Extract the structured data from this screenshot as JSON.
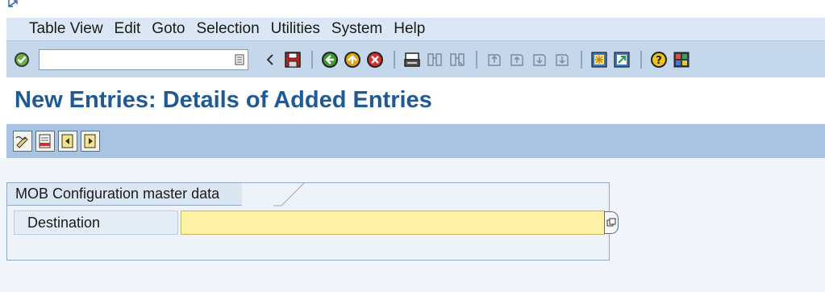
{
  "menu": {
    "items": [
      {
        "label": "Table View"
      },
      {
        "label": "Edit"
      },
      {
        "label": "Goto"
      },
      {
        "label": "Selection"
      },
      {
        "label": "Utilities"
      },
      {
        "label": "System"
      },
      {
        "label": "Help"
      }
    ]
  },
  "toolbar": {
    "command_field_value": "",
    "icons": [
      "enter-checkmark-icon",
      "command-dropdown-icon",
      "back-arrow-small-icon",
      "save-icon",
      "back-icon",
      "exit-icon",
      "cancel-icon",
      "print-icon",
      "find-icon",
      "find-next-icon",
      "first-page-icon",
      "previous-page-icon",
      "next-page-icon",
      "last-page-icon",
      "create-session-icon",
      "generate-shortcut-icon",
      "help-icon",
      "customize-layout-icon"
    ]
  },
  "page": {
    "title": "New Entries: Details of Added Entries"
  },
  "app_toolbar": {
    "icons": [
      "change-display-icon",
      "delete-icon",
      "previous-entry-icon",
      "next-entry-icon"
    ]
  },
  "group": {
    "title": "MOB Configuration master data",
    "fields": [
      {
        "label": "Destination",
        "value": ""
      }
    ]
  },
  "colors": {
    "title_blue": "#1f5a96",
    "toolbar_bg": "#c5d7ea",
    "app_toolbar_bg": "#a9c4e2",
    "required_field_bg": "#fdf1a6"
  }
}
